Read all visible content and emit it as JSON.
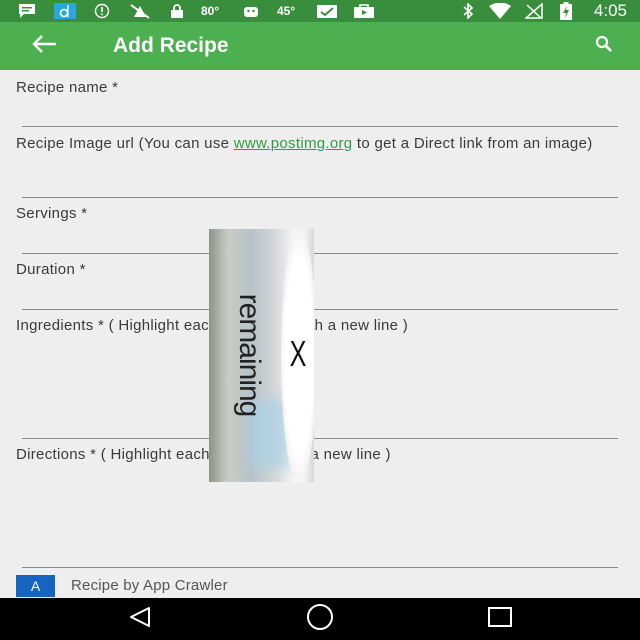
{
  "status_bar": {
    "time": "4:05",
    "temp1": "80°",
    "temp2": "45°",
    "icons": [
      "message-icon",
      "d-app-icon",
      "info-icon",
      "fire-off-icon",
      "lock-icon",
      "android-icon",
      "photo-check-icon",
      "play-bag-icon",
      "bluetooth-icon",
      "wifi-icon",
      "no-signal-icon",
      "battery-charging-icon"
    ]
  },
  "app_bar": {
    "title": "Add Recipe",
    "back_icon": "arrow-back-icon",
    "search_icon": "search-icon",
    "color": "#4caf50",
    "status_color": "#388e3c"
  },
  "form": {
    "recipe_name_label": "Recipe name *",
    "image_url_label_pre": "Recipe Image url (You can use ",
    "image_url_link": "www.postimg.org",
    "image_url_label_post": " to get a Direct link from an image)",
    "servings_label": "Servings *",
    "duration_label": "Duration *",
    "ingredients_label": "Ingredients * ( Highlight each ingredient with a new line )",
    "directions_label": "Directions * ( Highlight each direction with a new line )"
  },
  "overlay_ad": {
    "text": "remaining",
    "close_label": "X"
  },
  "footer": {
    "badge": "A",
    "text": "Recipe by App Crawler",
    "badge_color": "#1565c0"
  },
  "nav_bar": {
    "back_icon": "nav-back-icon",
    "home_icon": "nav-home-icon",
    "recents_icon": "nav-recents-icon"
  }
}
